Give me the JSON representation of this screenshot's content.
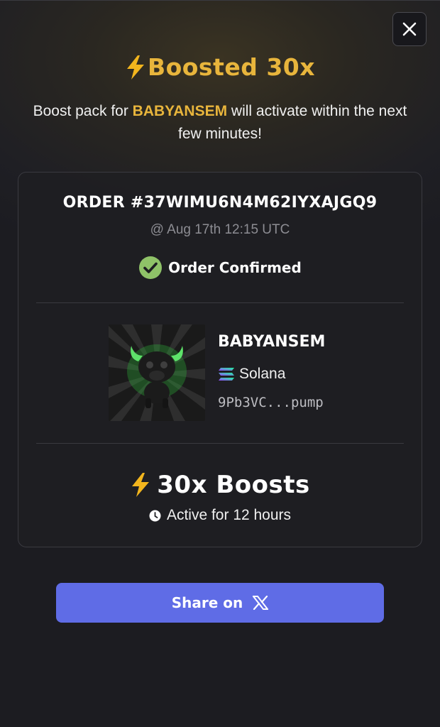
{
  "header": {
    "close_icon": "close-icon",
    "title": "Boosted 30x",
    "title_icon": "lightning-bolt-icon",
    "accent_color": "#e8b53c"
  },
  "message": {
    "prefix": "Boost pack for ",
    "token": "BABYANSEM",
    "suffix": " will activate within the next few minutes!"
  },
  "order": {
    "id": "ORDER #37WIMU6N4M62IYXAJGQ9",
    "time": "@ Aug 17th 12:15 UTC",
    "status": "Order Confirmed",
    "status_icon": "check-circle-icon",
    "status_color": "#8fc268"
  },
  "token": {
    "name": "BABYANSEM",
    "image": "green-bull-avatar",
    "chain": "Solana",
    "chain_icon": "solana-icon",
    "address": "9Pb3VC...pump"
  },
  "boost": {
    "label": "30x Boosts",
    "icon": "lightning-bolt-icon",
    "duration": "Active for 12 hours",
    "duration_icon": "clock-icon"
  },
  "share": {
    "label": "Share on",
    "icon": "x-logo-icon",
    "color": "#5f6ce6"
  }
}
